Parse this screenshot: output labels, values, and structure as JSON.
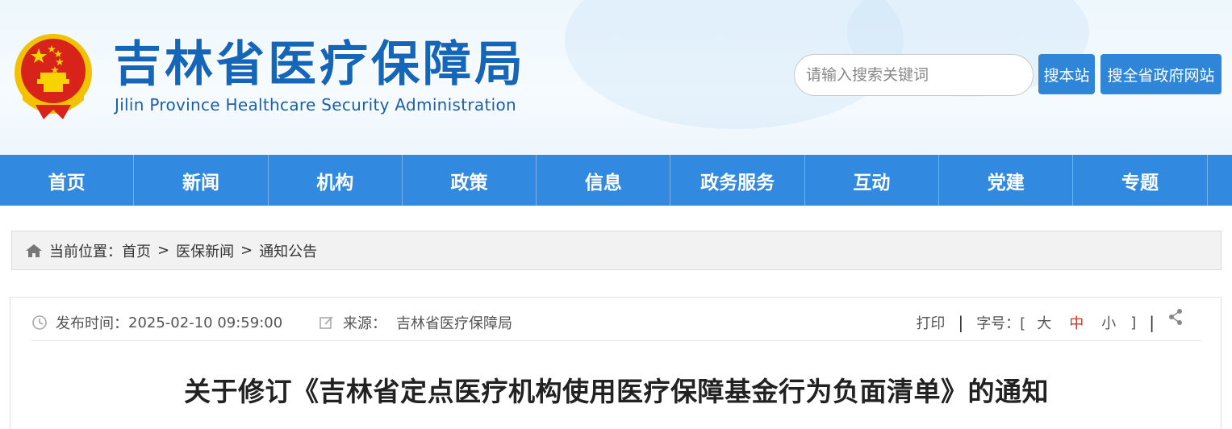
{
  "header": {
    "title": "吉林省医疗保障局",
    "subtitle": "Jilin Province Healthcare Security Administration",
    "search": {
      "placeholder": "请输入搜索关键词",
      "site_button": "搜本站",
      "province_button": "搜全省政府网站"
    },
    "emblem_icon": "national-emblem-icon",
    "colors": {
      "title": "#1565b8",
      "nav": "#3189e0",
      "button": "#2f86d8"
    }
  },
  "nav": {
    "items": [
      "首页",
      "新闻",
      "机构",
      "政策",
      "信息",
      "政务服务",
      "互动",
      "党建",
      "专题"
    ]
  },
  "breadcrumb": {
    "label": "当前位置：",
    "items": [
      "首页",
      "医保新闻",
      "通知公告"
    ],
    "separator": ">"
  },
  "article": {
    "publish_label": "发布时间：",
    "publish_time": "2025-02-10 09:59:00",
    "source_label": "来源：",
    "source": "吉林省医疗保障局",
    "print": "打印",
    "font_label": "字号：[",
    "font_sizes": [
      "大",
      "中",
      "小"
    ],
    "font_close": "]",
    "title": "关于修订《吉林省定点医疗机构使用医疗保障基金行为负面清单》的通知"
  }
}
